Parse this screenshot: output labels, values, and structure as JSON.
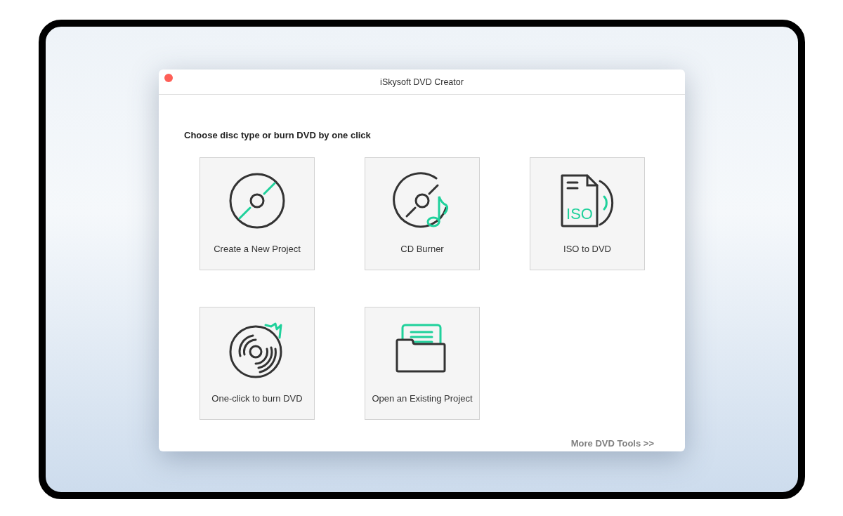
{
  "window": {
    "title": "iSkysoft DVD Creator"
  },
  "heading": "Choose disc type or burn DVD by one click",
  "tiles": [
    {
      "kind": "new-project",
      "label": "Create a New Project"
    },
    {
      "kind": "cd-burner",
      "label": "CD Burner"
    },
    {
      "kind": "iso",
      "label": "ISO to DVD",
      "icon_text": "ISO"
    },
    {
      "kind": "one-click",
      "label": "One-click to burn DVD"
    },
    {
      "kind": "open-project",
      "label": "Open an Existing Project"
    }
  ],
  "more_link": "More DVD Tools >>"
}
